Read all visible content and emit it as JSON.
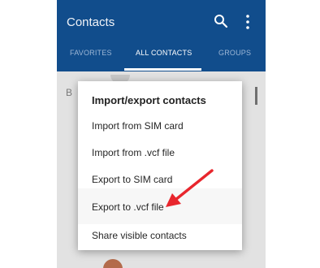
{
  "app": {
    "title": "Contacts",
    "icons": [
      "search-icon",
      "more-vert-icon"
    ]
  },
  "tabs": [
    {
      "label": "FAVORITES",
      "active": false
    },
    {
      "label": "ALL CONTACTS",
      "active": true
    },
    {
      "label": "GROUPS",
      "active": false
    }
  ],
  "list": {
    "section_letter": "B"
  },
  "dialog": {
    "title": "Import/export contacts",
    "options": [
      {
        "label": "Import from SIM card"
      },
      {
        "label": "Import from .vcf file"
      },
      {
        "label": "Export to SIM card"
      },
      {
        "label": "Export to .vcf file",
        "highlighted": true
      },
      {
        "label": "Share visible contacts"
      }
    ]
  },
  "annotation": {
    "arrow_color": "#e8262d",
    "points_to": "Export to .vcf file"
  },
  "colors": {
    "appbar": "#114d8c",
    "tab_inactive": "#9db7d6",
    "dim_background": "#e2e2e2"
  }
}
